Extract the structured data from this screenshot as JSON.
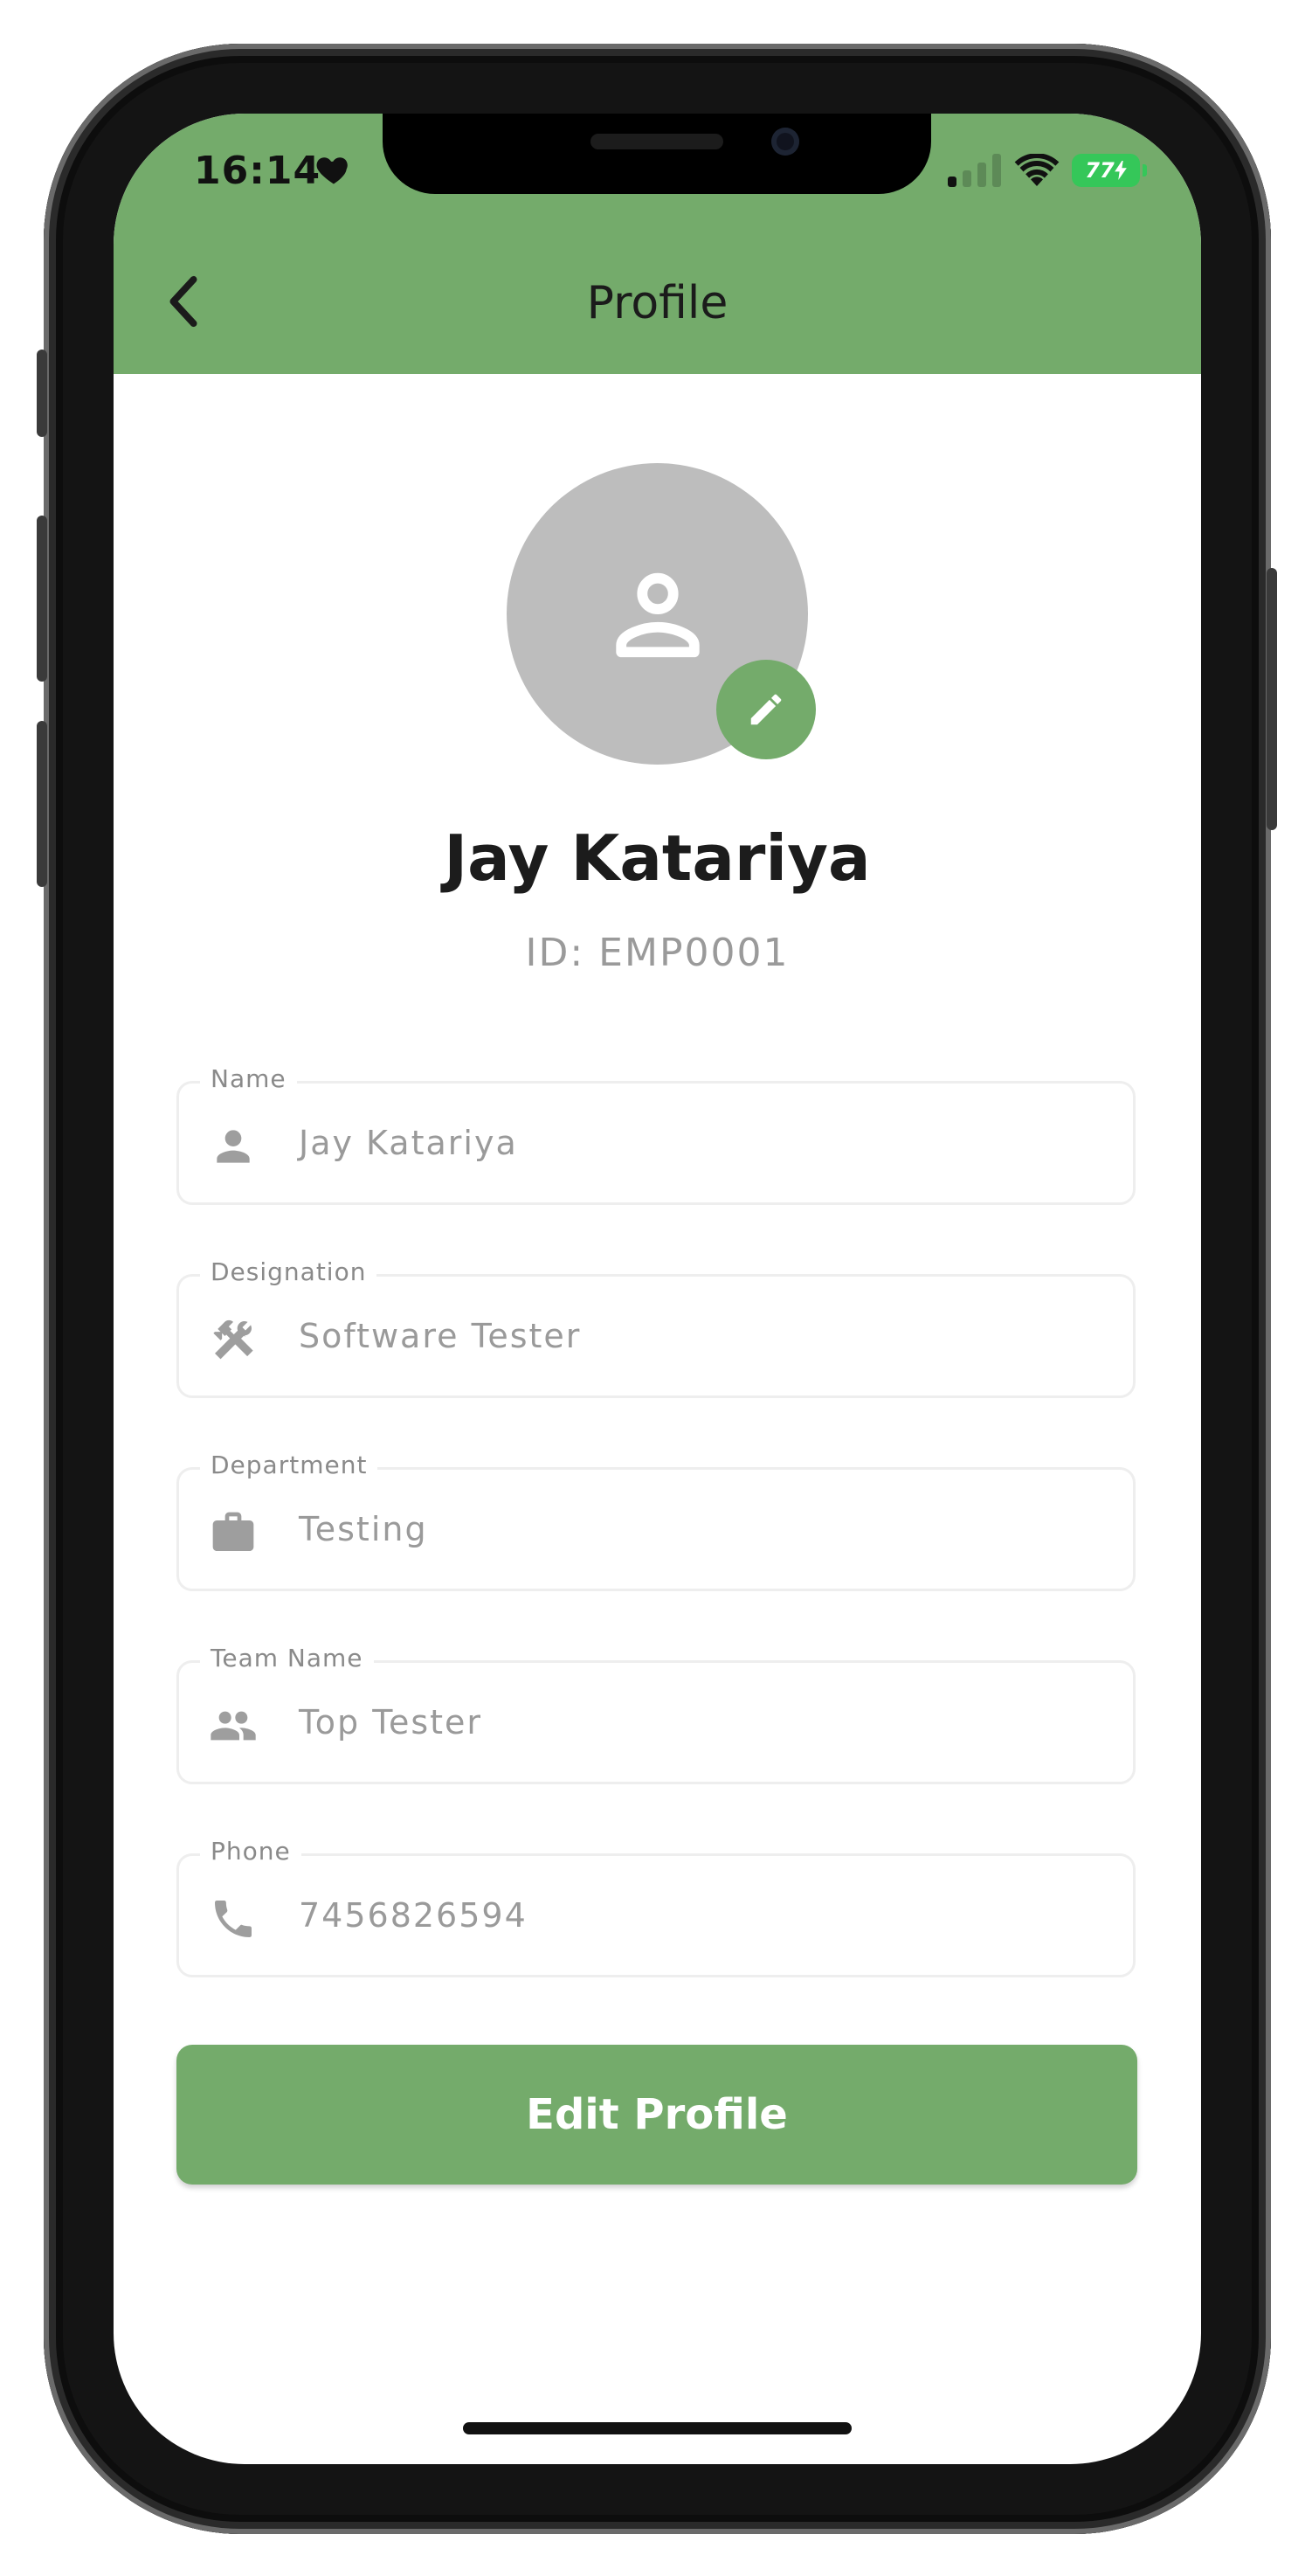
{
  "status_bar": {
    "time": "16:14",
    "battery": "77"
  },
  "header": {
    "title": "Profile"
  },
  "profile": {
    "name": "Jay Katariya",
    "id_text": "ID: EMP0001"
  },
  "fields": [
    {
      "label": "Name",
      "value": "Jay Katariya",
      "icon": "person-icon"
    },
    {
      "label": "Designation",
      "value": "Software Tester",
      "icon": "tools-icon"
    },
    {
      "label": "Department",
      "value": "Testing",
      "icon": "briefcase-icon"
    },
    {
      "label": "Team Name",
      "value": "Top Tester",
      "icon": "group-icon"
    },
    {
      "label": "Phone",
      "value": "7456826594",
      "icon": "phone-icon"
    }
  ],
  "actions": {
    "edit_profile_label": "Edit Profile"
  },
  "colors": {
    "accent": "#74ab6b",
    "avatar_bg": "#bdbdbd",
    "muted_text": "#9a9a9a"
  }
}
